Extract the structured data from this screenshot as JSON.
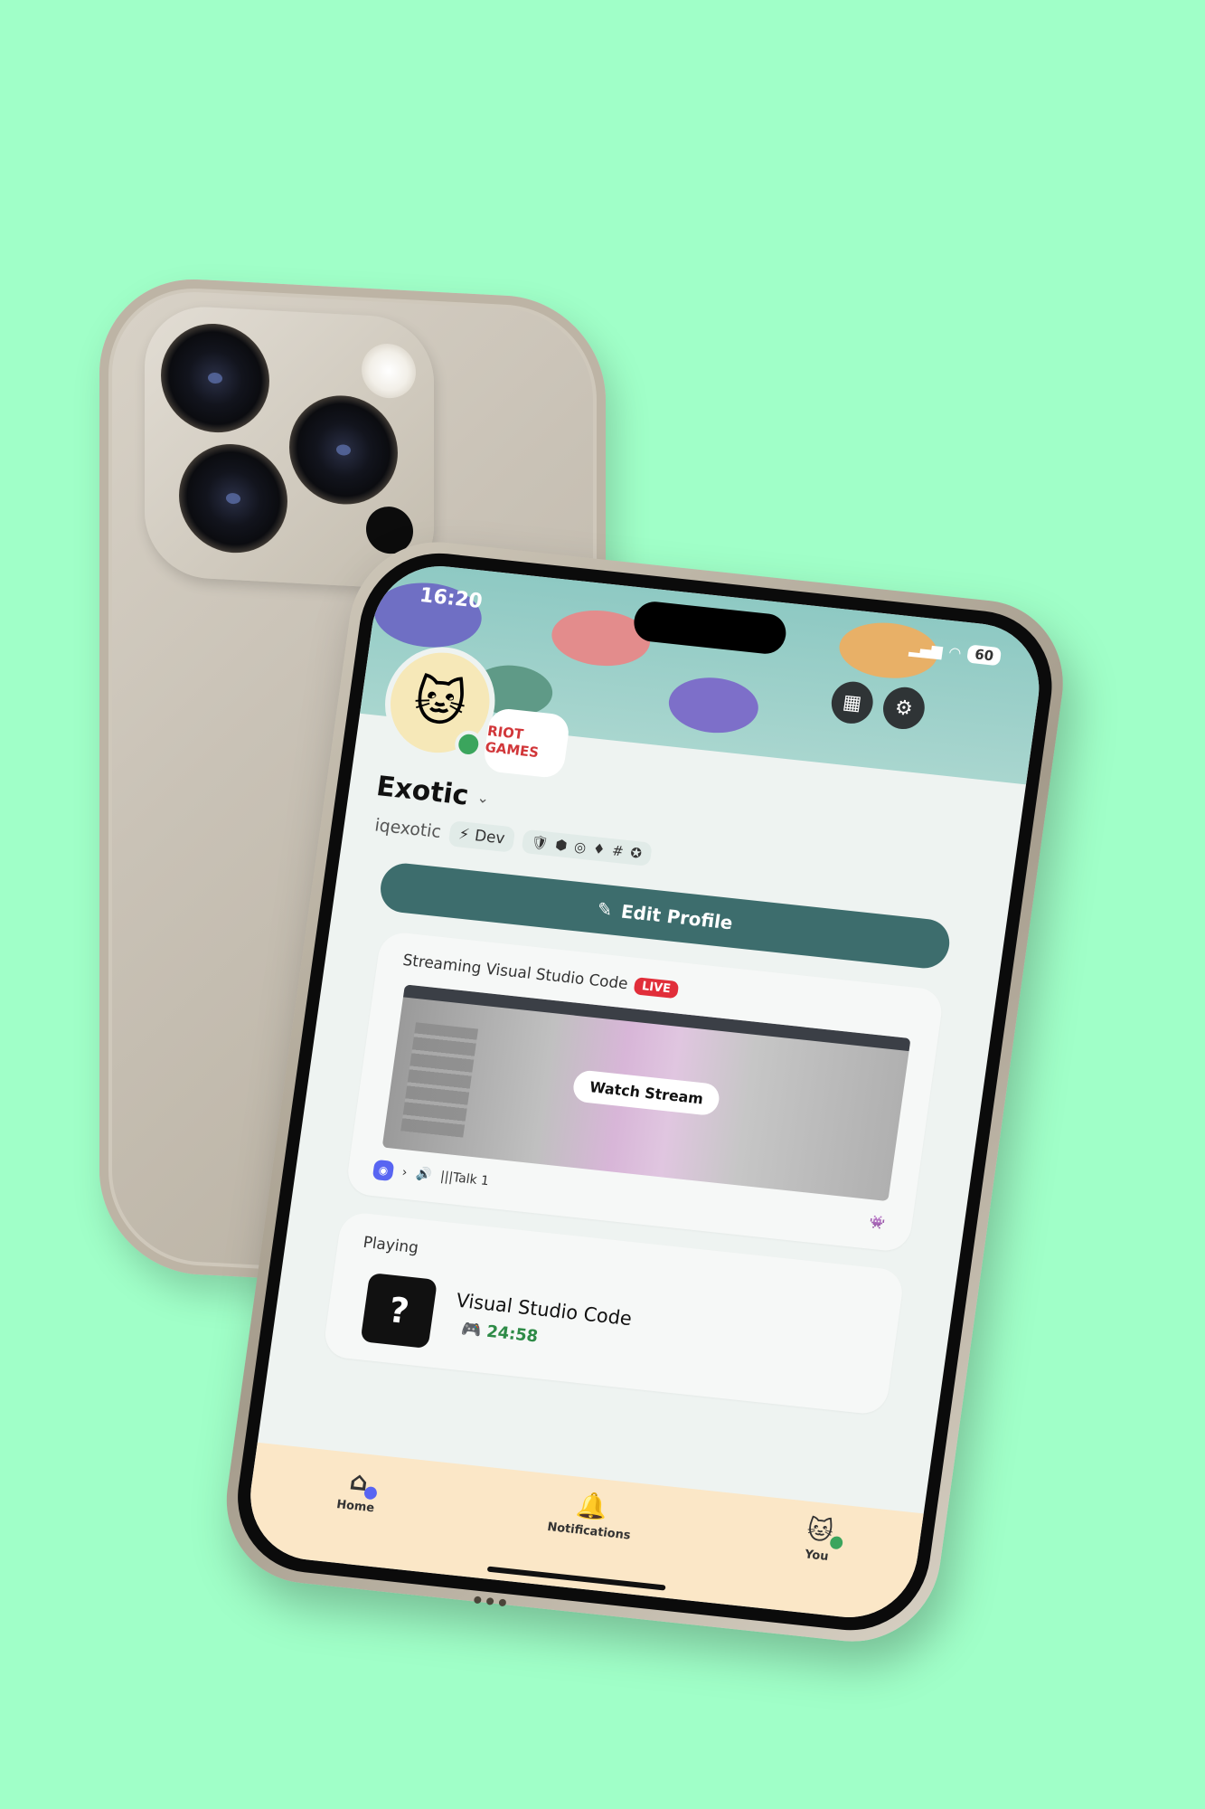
{
  "status": {
    "time": "16:20",
    "battery": "60"
  },
  "profile": {
    "display_name": "Exotic",
    "username": "iqexotic",
    "tag_label": "Dev",
    "connection_badge": "RIOT GAMES",
    "edit_label": "Edit Profile"
  },
  "stream": {
    "title": "Streaming Visual Studio Code",
    "live_label": "LIVE",
    "watch_label": "Watch Stream",
    "channel": "|||Talk 1"
  },
  "activity": {
    "label": "Playing",
    "game": "Visual Studio Code",
    "elapsed": "24:58",
    "icon_glyph": "?"
  },
  "tabs": [
    {
      "label": "Home",
      "icon": "home-icon"
    },
    {
      "label": "Notifications",
      "icon": "bell-icon"
    },
    {
      "label": "You",
      "icon": "avatar-icon"
    }
  ],
  "colors": {
    "background": "#a0ffc8",
    "accent": "#3d6d6d",
    "live": "#e12e3a",
    "online": "#3ba55d",
    "tabbar": "#fbe7c7"
  }
}
